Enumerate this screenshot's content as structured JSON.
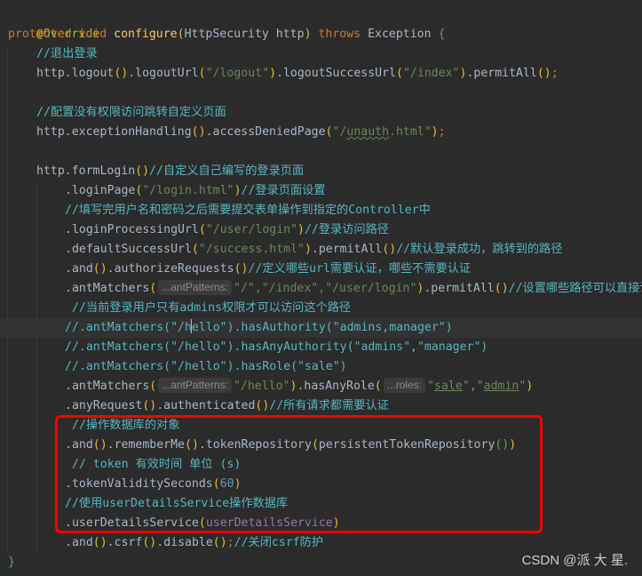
{
  "code": {
    "annotation": "@Override",
    "signature": {
      "modifier": "protected",
      "return_type": "void",
      "method_name": "configure",
      "param_type": "HttpSecurity",
      "param_name": "http",
      "throws_kw": "throws",
      "exception": "Exception"
    },
    "comment_logout": "//退出登录",
    "logout_line": {
      "prefix": "http.logout",
      "mid1": ".logoutUrl",
      "url1": "\"/logout\"",
      "mid2": ".logoutSuccessUrl",
      "url2": "\"/index\"",
      "suffix": ".permitAll"
    },
    "comment_denied": "//配置没有权限访问跳转自定义页面",
    "denied_line": {
      "prefix": "http.exceptionHandling",
      "mid": ".accessDeniedPage",
      "url_a": "\"/",
      "url_b": "unauth",
      "url_c": ".html\""
    },
    "formlogin": {
      "call": "http.formLogin",
      "comment": "//自定义自己编写的登录页面"
    },
    "loginpage": {
      "call": ".loginPage",
      "url": "\"/login.html\"",
      "comment": "//登录页面设置"
    },
    "comment_processing": "//填写完用户名和密码之后需要提交表单操作到指定的Controller中",
    "processing": {
      "call": ".loginProcessingUrl",
      "url": "\"/user/login\"",
      "comment": "//登录访问路径"
    },
    "success": {
      "call": ".defaultSuccessUrl",
      "url": "\"/success.html\"",
      "permit": ".permitAll",
      "comment": "//默认登录成功，跳转到的路径"
    },
    "authorize": {
      "and": ".and",
      "call": ".authorizeRequests",
      "comment": "//定义哪些url需要认证，哪些不需要认证"
    },
    "antmatch1": {
      "call": ".antMatchers",
      "hint": "...antPatterns:",
      "urls": "\"/\",\"/index\",\"/user/login\"",
      "permit": ".permitAll",
      "comment": "//设置哪些路径可以直接访问"
    },
    "comment_admins": "//当前登录用户只有admins权限才可以访问这个路径",
    "commented_1": {
      "a": "//.antMatchers(\"/h",
      "b": "ello\").hasAuthority(\"admins,manager\")"
    },
    "commented_2": "//.antMatchers(\"/hello\").hasAnyAuthority(\"admins\",\"manager\")",
    "commented_3": "//.antMatchers(\"/hello\").hasRole(\"sale\")",
    "antmatch2": {
      "call": ".antMatchers",
      "hint": "...antPatterns:",
      "url": "\"/hello\"",
      "role_call": ".hasAnyRole",
      "roles_hint": "...roles:",
      "role1": "sale",
      "role2": "admin"
    },
    "anyrequest": {
      "call": ".anyRequest",
      "auth": ".authenticated",
      "comment": "//所有请求都需要认证"
    },
    "comment_db": "//操作数据库的对象",
    "rememberme": {
      "and": ".and",
      "call": ".rememberMe",
      "repo": ".tokenRepository",
      "arg": "persistentTokenRepository"
    },
    "comment_token": "// token 有效时间 单位 (s)",
    "validity": {
      "call": ".tokenValiditySeconds",
      "value": "60"
    },
    "comment_uds": "//使用userDetailsService操作数据库",
    "uds": {
      "call": ".userDetailsService",
      "arg": "userDetailsService"
    },
    "csrf": {
      "and": ".and",
      "call": ".csrf",
      "disable": ".disable",
      "comment": "//关闭csrf防护"
    },
    "close_brace": "}",
    "open_brace": "{"
  },
  "watermark": "CSDN @派 大 星."
}
